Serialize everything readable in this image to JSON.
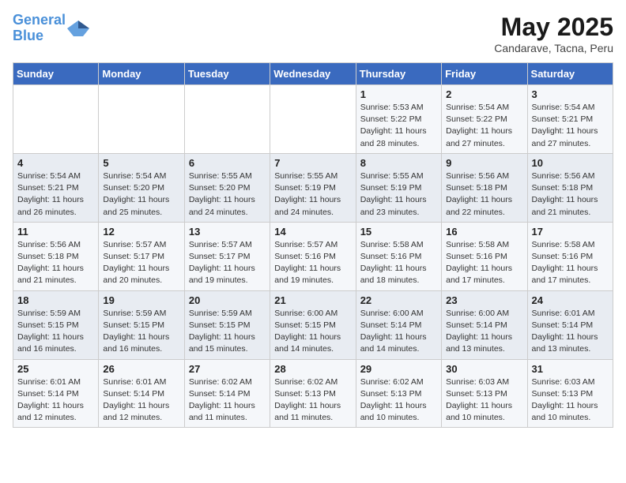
{
  "header": {
    "logo_line1": "General",
    "logo_line2": "Blue",
    "month_year": "May 2025",
    "location": "Candarave, Tacna, Peru"
  },
  "weekdays": [
    "Sunday",
    "Monday",
    "Tuesday",
    "Wednesday",
    "Thursday",
    "Friday",
    "Saturday"
  ],
  "weeks": [
    [
      {
        "day": "",
        "detail": ""
      },
      {
        "day": "",
        "detail": ""
      },
      {
        "day": "",
        "detail": ""
      },
      {
        "day": "",
        "detail": ""
      },
      {
        "day": "1",
        "detail": "Sunrise: 5:53 AM\nSunset: 5:22 PM\nDaylight: 11 hours\nand 28 minutes."
      },
      {
        "day": "2",
        "detail": "Sunrise: 5:54 AM\nSunset: 5:22 PM\nDaylight: 11 hours\nand 27 minutes."
      },
      {
        "day": "3",
        "detail": "Sunrise: 5:54 AM\nSunset: 5:21 PM\nDaylight: 11 hours\nand 27 minutes."
      }
    ],
    [
      {
        "day": "4",
        "detail": "Sunrise: 5:54 AM\nSunset: 5:21 PM\nDaylight: 11 hours\nand 26 minutes."
      },
      {
        "day": "5",
        "detail": "Sunrise: 5:54 AM\nSunset: 5:20 PM\nDaylight: 11 hours\nand 25 minutes."
      },
      {
        "day": "6",
        "detail": "Sunrise: 5:55 AM\nSunset: 5:20 PM\nDaylight: 11 hours\nand 24 minutes."
      },
      {
        "day": "7",
        "detail": "Sunrise: 5:55 AM\nSunset: 5:19 PM\nDaylight: 11 hours\nand 24 minutes."
      },
      {
        "day": "8",
        "detail": "Sunrise: 5:55 AM\nSunset: 5:19 PM\nDaylight: 11 hours\nand 23 minutes."
      },
      {
        "day": "9",
        "detail": "Sunrise: 5:56 AM\nSunset: 5:18 PM\nDaylight: 11 hours\nand 22 minutes."
      },
      {
        "day": "10",
        "detail": "Sunrise: 5:56 AM\nSunset: 5:18 PM\nDaylight: 11 hours\nand 21 minutes."
      }
    ],
    [
      {
        "day": "11",
        "detail": "Sunrise: 5:56 AM\nSunset: 5:18 PM\nDaylight: 11 hours\nand 21 minutes."
      },
      {
        "day": "12",
        "detail": "Sunrise: 5:57 AM\nSunset: 5:17 PM\nDaylight: 11 hours\nand 20 minutes."
      },
      {
        "day": "13",
        "detail": "Sunrise: 5:57 AM\nSunset: 5:17 PM\nDaylight: 11 hours\nand 19 minutes."
      },
      {
        "day": "14",
        "detail": "Sunrise: 5:57 AM\nSunset: 5:16 PM\nDaylight: 11 hours\nand 19 minutes."
      },
      {
        "day": "15",
        "detail": "Sunrise: 5:58 AM\nSunset: 5:16 PM\nDaylight: 11 hours\nand 18 minutes."
      },
      {
        "day": "16",
        "detail": "Sunrise: 5:58 AM\nSunset: 5:16 PM\nDaylight: 11 hours\nand 17 minutes."
      },
      {
        "day": "17",
        "detail": "Sunrise: 5:58 AM\nSunset: 5:16 PM\nDaylight: 11 hours\nand 17 minutes."
      }
    ],
    [
      {
        "day": "18",
        "detail": "Sunrise: 5:59 AM\nSunset: 5:15 PM\nDaylight: 11 hours\nand 16 minutes."
      },
      {
        "day": "19",
        "detail": "Sunrise: 5:59 AM\nSunset: 5:15 PM\nDaylight: 11 hours\nand 16 minutes."
      },
      {
        "day": "20",
        "detail": "Sunrise: 5:59 AM\nSunset: 5:15 PM\nDaylight: 11 hours\nand 15 minutes."
      },
      {
        "day": "21",
        "detail": "Sunrise: 6:00 AM\nSunset: 5:15 PM\nDaylight: 11 hours\nand 14 minutes."
      },
      {
        "day": "22",
        "detail": "Sunrise: 6:00 AM\nSunset: 5:14 PM\nDaylight: 11 hours\nand 14 minutes."
      },
      {
        "day": "23",
        "detail": "Sunrise: 6:00 AM\nSunset: 5:14 PM\nDaylight: 11 hours\nand 13 minutes."
      },
      {
        "day": "24",
        "detail": "Sunrise: 6:01 AM\nSunset: 5:14 PM\nDaylight: 11 hours\nand 13 minutes."
      }
    ],
    [
      {
        "day": "25",
        "detail": "Sunrise: 6:01 AM\nSunset: 5:14 PM\nDaylight: 11 hours\nand 12 minutes."
      },
      {
        "day": "26",
        "detail": "Sunrise: 6:01 AM\nSunset: 5:14 PM\nDaylight: 11 hours\nand 12 minutes."
      },
      {
        "day": "27",
        "detail": "Sunrise: 6:02 AM\nSunset: 5:14 PM\nDaylight: 11 hours\nand 11 minutes."
      },
      {
        "day": "28",
        "detail": "Sunrise: 6:02 AM\nSunset: 5:13 PM\nDaylight: 11 hours\nand 11 minutes."
      },
      {
        "day": "29",
        "detail": "Sunrise: 6:02 AM\nSunset: 5:13 PM\nDaylight: 11 hours\nand 10 minutes."
      },
      {
        "day": "30",
        "detail": "Sunrise: 6:03 AM\nSunset: 5:13 PM\nDaylight: 11 hours\nand 10 minutes."
      },
      {
        "day": "31",
        "detail": "Sunrise: 6:03 AM\nSunset: 5:13 PM\nDaylight: 11 hours\nand 10 minutes."
      }
    ]
  ]
}
